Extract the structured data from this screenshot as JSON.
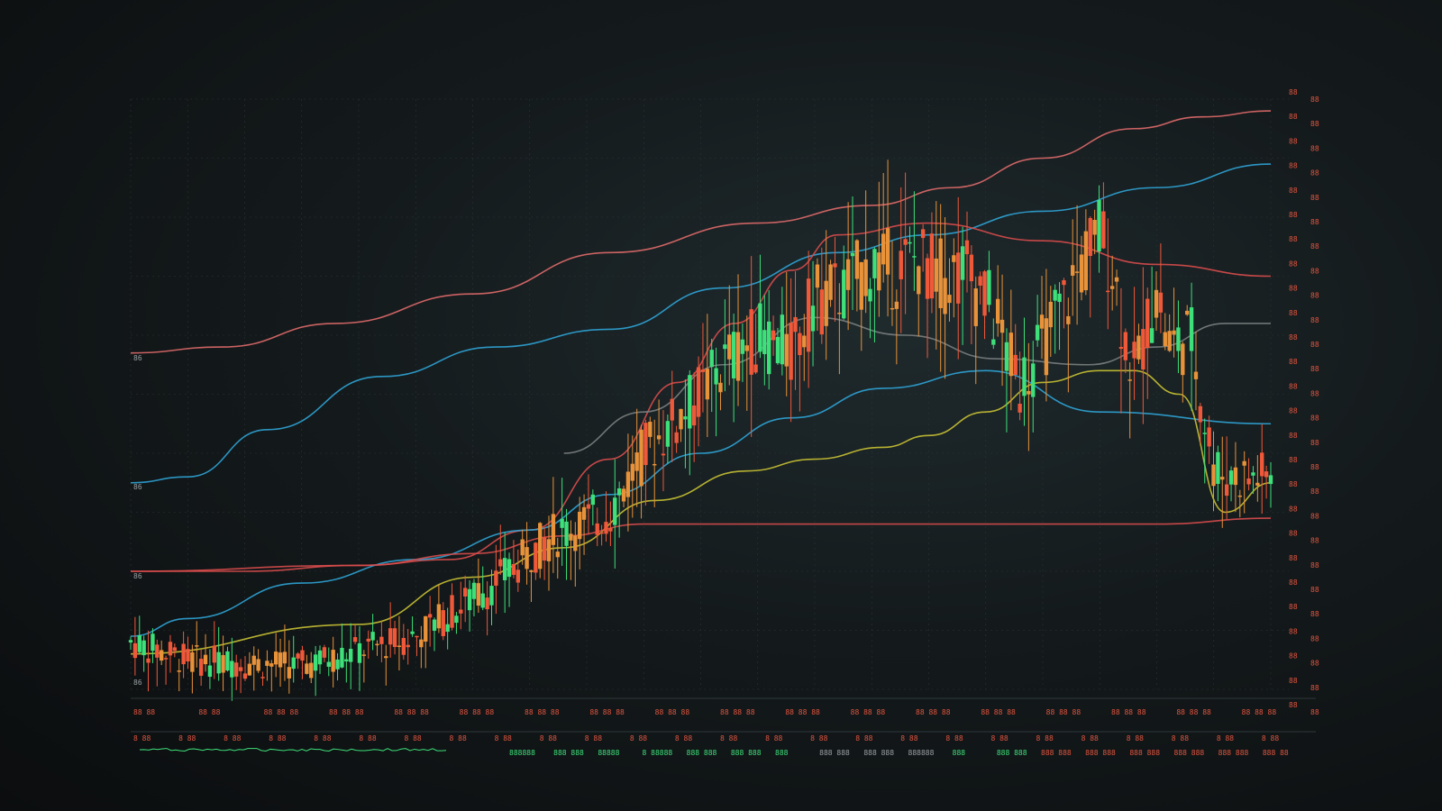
{
  "chart_data": {
    "type": "candlestick",
    "title": "",
    "xlabel": "",
    "ylabel": "",
    "grid": true,
    "legend": "none",
    "ylim": [
      0,
      100
    ],
    "colors": {
      "background": "#111719",
      "grid": "#2a3336",
      "up": "#3ee07a",
      "down": "#f0583a",
      "neutral": "#e8923a",
      "ma_pink": "#e06a6a",
      "ma_blue": "#2fa4d6",
      "ma_red": "#d94d4d",
      "ma_yellow": "#c9c234",
      "ma_grey": "#7b7f80"
    },
    "left_axis_labels": [
      "86",
      "86",
      "86",
      "86"
    ],
    "right_axis_labels": [
      "88",
      "88",
      "88",
      "88",
      "88",
      "88",
      "88",
      "88",
      "88",
      "88",
      "88",
      "88",
      "88",
      "88",
      "88",
      "88",
      "88",
      "88",
      "88",
      "88",
      "88",
      "88",
      "88",
      "88",
      "88",
      "88"
    ],
    "bottom_label_rows": [
      [
        "88 88",
        "88 88",
        "88 88 88",
        "88 88 88",
        "88 88 88",
        "88 88 88",
        "88 88 88",
        "88 88 88",
        "88 88 88",
        "88 88 88",
        "88 88 88",
        "88 88 88",
        "88 88 88",
        "88 88 88",
        "88 88 88",
        "88 88 88",
        "88 88 88",
        "88 88 88"
      ],
      [
        "8 88",
        "8 88",
        "8 88",
        "8 88",
        "8 88",
        "8 88",
        "8 88",
        "8 88",
        "8 88",
        "8 88",
        "8 88",
        "8 88",
        "8 88",
        "8 88",
        "8 88",
        "8 88",
        "8 88",
        "8 88",
        "8 88",
        "8 88",
        "8 88",
        "8 88",
        "8 88",
        "8 88",
        "8 88",
        "8 88"
      ],
      [
        "888888",
        "888 888",
        "88888",
        "8 88888",
        "888 888",
        "888 888",
        "888",
        "888 888",
        "888 888",
        "888888",
        "888",
        "888 888",
        "888 888",
        "888 888",
        "888 888",
        "888 888",
        "888 888",
        "888 88"
      ]
    ],
    "candle_anchors": [
      [
        0,
        8
      ],
      [
        5,
        5
      ],
      [
        15,
        4
      ],
      [
        25,
        9
      ],
      [
        32,
        18
      ],
      [
        37,
        26
      ],
      [
        42,
        30
      ],
      [
        45,
        40
      ],
      [
        49,
        48
      ],
      [
        52,
        55
      ],
      [
        55,
        60
      ],
      [
        58,
        57
      ],
      [
        60,
        66
      ],
      [
        63,
        68
      ],
      [
        65,
        72
      ],
      [
        67,
        71
      ],
      [
        69,
        73
      ],
      [
        71,
        70
      ],
      [
        73,
        71
      ],
      [
        75,
        66
      ],
      [
        76,
        62
      ],
      [
        77,
        56
      ],
      [
        78,
        52
      ],
      [
        80,
        58
      ],
      [
        82,
        66
      ],
      [
        84,
        74
      ],
      [
        85,
        77
      ],
      [
        86,
        73
      ],
      [
        87,
        62
      ],
      [
        88,
        53
      ],
      [
        90,
        68
      ],
      [
        91,
        58
      ],
      [
        93,
        60
      ],
      [
        94,
        48
      ],
      [
        95,
        38
      ],
      [
        96,
        36
      ]
    ],
    "candle_count": 260,
    "series": [
      {
        "role": "ma_pink",
        "color": "#e06a6a",
        "x": [
          0,
          8,
          18,
          30,
          42,
          55,
          65,
          72,
          80,
          88,
          94,
          100
        ],
        "y": [
          57,
          58,
          62,
          67,
          74,
          79,
          82,
          85,
          90,
          95,
          97,
          98
        ]
      },
      {
        "role": "ma_blue",
        "color": "#2fa4d6",
        "x": [
          0,
          5,
          12,
          22,
          32,
          42,
          52,
          62,
          70,
          80,
          90,
          100
        ],
        "y": [
          35,
          36,
          44,
          53,
          58,
          61,
          68,
          74,
          77,
          81,
          85,
          89
        ]
      },
      {
        "role": "ma_red_upper",
        "color": "#d94d4d",
        "x": [
          0,
          10,
          20,
          28,
          35,
          42,
          48,
          53,
          58,
          62,
          70,
          80,
          90,
          100
        ],
        "y": [
          20,
          20,
          21,
          22,
          27,
          39,
          52,
          62,
          71,
          77,
          79,
          76,
          72,
          70
        ]
      },
      {
        "role": "ma_blue_lower",
        "color": "#2fa4d6",
        "x": [
          0,
          5,
          15,
          25,
          35,
          42,
          50,
          58,
          66,
          75,
          85,
          100
        ],
        "y": [
          9,
          12,
          18,
          22,
          27,
          33,
          40,
          46,
          51,
          54,
          47,
          45
        ]
      },
      {
        "role": "ma_yellow",
        "color": "#c9c234",
        "x": [
          0,
          20,
          30,
          38,
          46,
          54,
          60,
          66,
          70,
          75,
          80,
          85,
          88,
          92,
          96,
          100
        ],
        "y": [
          6,
          11,
          19,
          24,
          32,
          37,
          39,
          41,
          43,
          47,
          52,
          54,
          54,
          50,
          30,
          35
        ]
      },
      {
        "role": "ma_red_flat",
        "color": "#d94d4d",
        "x": [
          0,
          20,
          30,
          38,
          45,
          52,
          62,
          72,
          82,
          90,
          100
        ],
        "y": [
          20,
          21,
          23,
          26,
          28,
          28,
          28,
          28,
          28,
          28,
          29
        ]
      },
      {
        "role": "ma_grey",
        "color": "#7b7f80",
        "x": [
          38,
          45,
          52,
          60,
          68,
          76,
          84,
          90,
          96,
          100
        ],
        "y": [
          40,
          47,
          55,
          63,
          60,
          56,
          55,
          58,
          62,
          62
        ]
      }
    ]
  }
}
